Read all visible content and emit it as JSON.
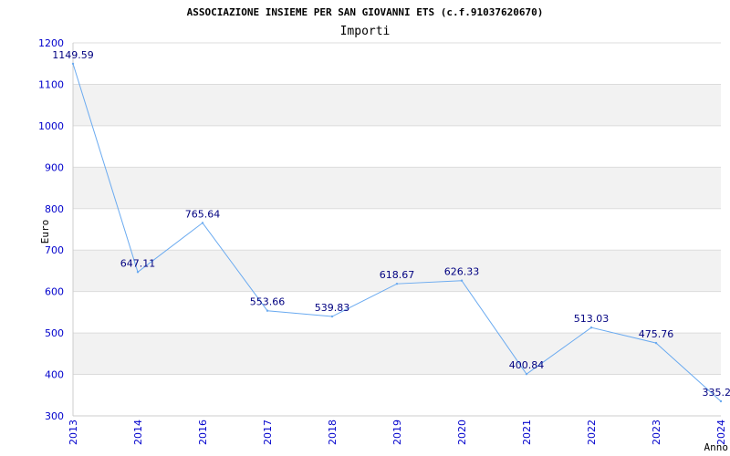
{
  "chart_data": {
    "type": "line",
    "title": "ASSOCIAZIONE INSIEME PER SAN GIOVANNI ETS (c.f.91037620670)",
    "subtitle": "Importi",
    "xlabel": "Anno",
    "ylabel": "Euro",
    "ylim": [
      300,
      1200
    ],
    "yticks": [
      "300",
      "400",
      "500",
      "600",
      "700",
      "800",
      "900",
      "1000",
      "1100",
      "1200"
    ],
    "categories": [
      "2013",
      "2014",
      "2016",
      "2017",
      "2018",
      "2019",
      "2020",
      "2021",
      "2022",
      "2023",
      "2024"
    ],
    "values": [
      1149.59,
      647.11,
      765.64,
      553.66,
      539.83,
      618.67,
      626.33,
      400.84,
      513.03,
      475.76,
      335.2
    ],
    "data_labels": [
      "1149.59",
      "647.11",
      "765.64",
      "553.66",
      "539.83",
      "618.67",
      "626.33",
      "400.84",
      "513.03",
      "475.76",
      "335.2"
    ],
    "grid": true,
    "colors": {
      "line": "#6aaaf0",
      "band": "#f2f2f2",
      "tick_text": "#0000cc",
      "label_text": "#000080",
      "title_text": "#000000"
    }
  }
}
